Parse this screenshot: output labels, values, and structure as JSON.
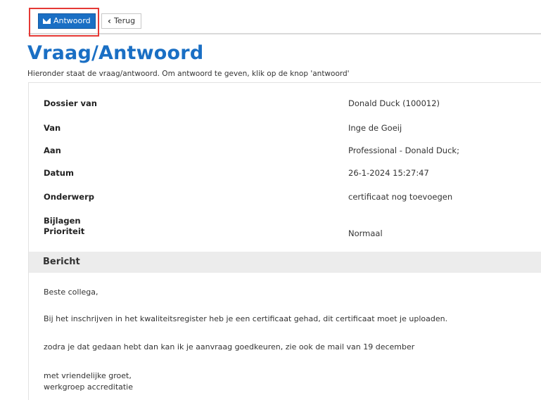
{
  "toolbar": {
    "reply_label": "Antwoord",
    "back_label": "Terug"
  },
  "page": {
    "title": "Vraag/Antwoord",
    "subtitle": "Hieronder staat de vraag/antwoord. Om antwoord te geven, klik op de knop 'antwoord'"
  },
  "details": {
    "dossier_label": "Dossier van",
    "dossier_value": "Donald Duck (100012)",
    "van_label": "Van",
    "van_value": "Inge de Goeij",
    "aan_label": "Aan",
    "aan_value": "Professional - Donald Duck;",
    "datum_label": "Datum",
    "datum_value": "26-1-2024 15:27:47",
    "onderwerp_label": "Onderwerp",
    "onderwerp_value": "certificaat nog toevoegen",
    "bijlagen_label": "Bijlagen",
    "prioriteit_label": "Prioriteit",
    "prioriteit_value": "Normaal"
  },
  "message": {
    "section_label": "Bericht",
    "line1": "Beste collega,",
    "line2": "Bij het inschrijven in het kwaliteitsregister heb je een certificaat gehad, dit certificaat moet je uploaden.",
    "line3": "zodra je dat gedaan hebt dan kan ik je aanvraag goedkeuren, zie ook de mail van 19 december",
    "line4": "met vriendelijke groet,",
    "line5": "werkgroep accreditatie"
  },
  "colors": {
    "accent": "#1a6fc4",
    "highlight": "#e53935",
    "section_bg": "#ececec"
  }
}
